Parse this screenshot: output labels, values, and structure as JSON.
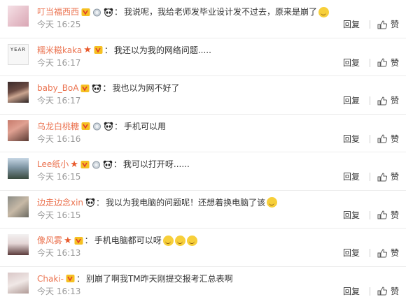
{
  "comments": [
    {
      "user": "叮当福西西",
      "badges": [
        "vip",
        "medal",
        "panda"
      ],
      "star": false,
      "text": "我说呢，我给老师发毕业设计发不过去，原来是崩了",
      "emoji": true,
      "time": "今天 16:25"
    },
    {
      "user": "糯米糍kaka",
      "badges": [
        "vip"
      ],
      "star": true,
      "text": "我还以为我的网络问题.....",
      "emoji": false,
      "time": "今天 16:17",
      "avatar_text": "YEAR"
    },
    {
      "user": "baby_BoA",
      "badges": [
        "vip",
        "panda"
      ],
      "star": false,
      "text": "我也以为网不好了",
      "emoji": false,
      "time": "今天 16:17"
    },
    {
      "user": "乌龙白桃糖",
      "badges": [
        "vip",
        "medal",
        "panda"
      ],
      "star": false,
      "text": "手机可以用",
      "emoji": false,
      "time": "今天 16:16"
    },
    {
      "user": "Lee纸小",
      "badges": [
        "vip",
        "medal",
        "panda"
      ],
      "star": true,
      "text": "我可以打开呀......",
      "emoji": false,
      "time": "今天 16:15"
    },
    {
      "user": "边走边念xin",
      "badges": [
        "panda"
      ],
      "star": false,
      "text": "我以为我电脑的问题呢！还想着换电脑了该",
      "emoji": true,
      "time": "今天 16:15"
    },
    {
      "user": "像风雾",
      "badges": [
        "vip"
      ],
      "star": true,
      "text": "手机电脑都可以呀",
      "emoji": true,
      "emoji_count": 3,
      "time": "今天 16:13"
    },
    {
      "user": "Chaki-",
      "badges": [
        "vip"
      ],
      "star": false,
      "text": "别崩了啊我TM昨天刚提交报考汇总表啊",
      "emoji": false,
      "time": "今天 16:13"
    }
  ],
  "actions": {
    "reply": "回复",
    "like": "赞"
  },
  "colors": {
    "username": "#eb7350",
    "time": "#999999",
    "divider": "#ececec"
  }
}
